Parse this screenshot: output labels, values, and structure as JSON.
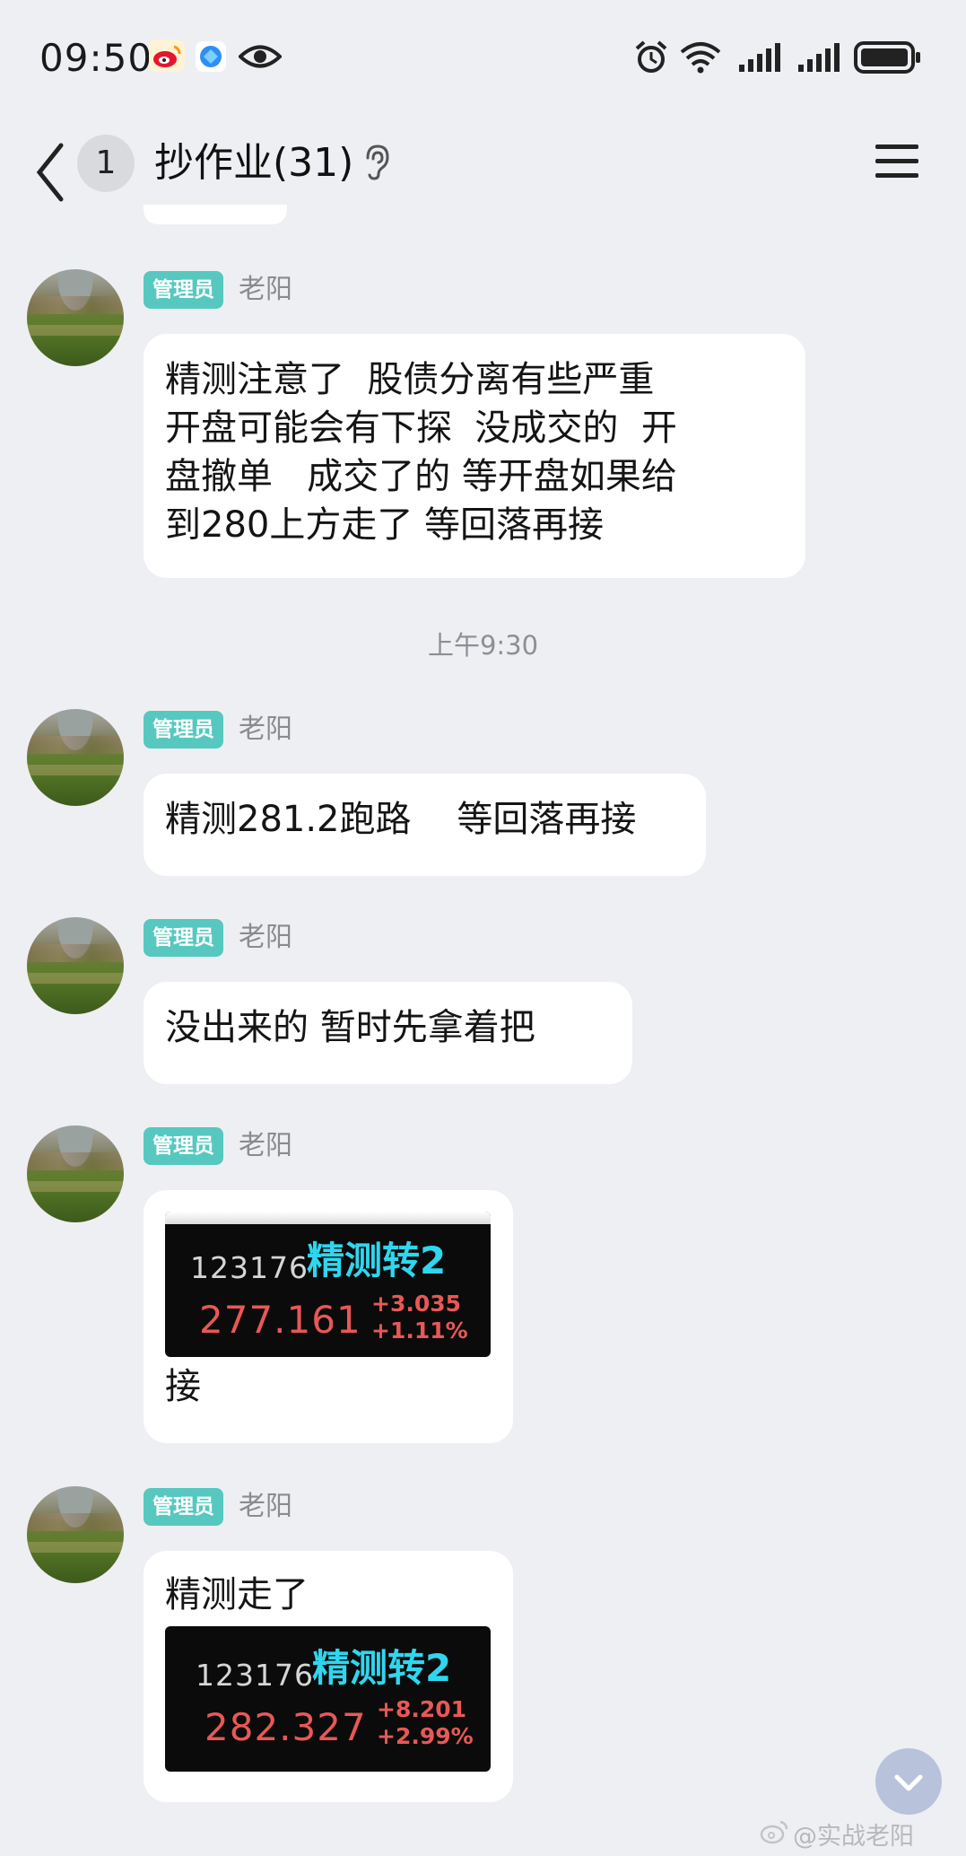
{
  "status_bar": {
    "time": "09:50",
    "icons": [
      "weibo-icon",
      "browser-icon",
      "eye-icon",
      "alarm-icon",
      "wifi-icon",
      "signal-icon",
      "signal-icon",
      "battery-icon"
    ]
  },
  "header": {
    "unread_count": "1",
    "title": "抄作业(31)",
    "icons": [
      "back-icon",
      "ear-icon",
      "menu-icon"
    ]
  },
  "messages": [
    {
      "tag": "管理员",
      "sender": "老阳",
      "text": "精测注意了  股债分离有些严重\n开盘可能会有下探  没成交的  开\n盘撤单   成交了的 等开盘如果给\n到280上方走了 等回落再接"
    },
    {
      "tag": "管理员",
      "sender": "老阳",
      "text": "精测281.2跑路    等回落再接"
    },
    {
      "tag": "管理员",
      "sender": "老阳",
      "text": "没出来的 暂时先拿着把"
    },
    {
      "tag": "管理员",
      "sender": "老阳",
      "stock": {
        "code": "123176",
        "name": "精测转2",
        "price": "277.161",
        "change": "+3.035",
        "pct": "+1.11%"
      },
      "text": "接"
    },
    {
      "tag": "管理员",
      "sender": "老阳",
      "text": "精测走了",
      "stock": {
        "code": "123176",
        "name": "精测转2",
        "price": "282.327",
        "change": "+8.201",
        "pct": "+2.99%"
      }
    }
  ],
  "time_divider": "上午9:30",
  "watermark": "@实战老阳",
  "colors": {
    "background": "#eeeff3",
    "admin_tag": "#56c8c0",
    "stock_name": "#2fd6ee",
    "stock_up": "#e85856"
  }
}
